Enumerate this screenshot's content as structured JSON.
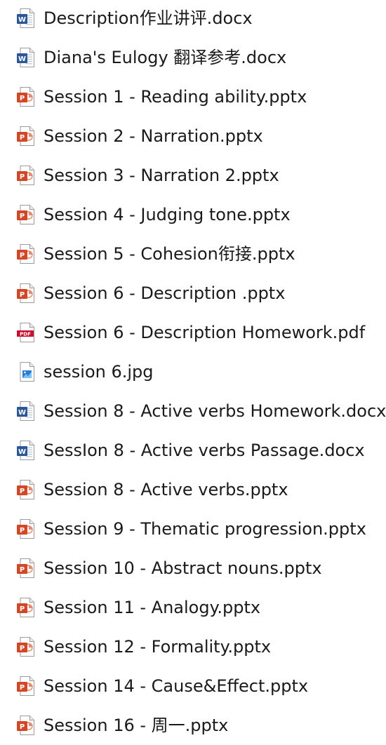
{
  "files": [
    {
      "name": "Description作业讲评.docx",
      "icon": "word-doc-icon"
    },
    {
      "name": "Diana's Eulogy 翻译参考.docx",
      "icon": "word-doc-icon"
    },
    {
      "name": "Session 1 - Reading ability.pptx",
      "icon": "powerpoint-icon"
    },
    {
      "name": "Session 2 - Narration.pptx",
      "icon": "powerpoint-icon"
    },
    {
      "name": "Session 3 - Narration 2.pptx",
      "icon": "powerpoint-icon"
    },
    {
      "name": "Session 4 - Judging tone.pptx",
      "icon": "powerpoint-icon"
    },
    {
      "name": "Session 5 - Cohesion衔接.pptx",
      "icon": "powerpoint-icon"
    },
    {
      "name": "Session 6 - Description .pptx",
      "icon": "powerpoint-icon"
    },
    {
      "name": "Session 6 - Description Homework.pdf",
      "icon": "pdf-icon"
    },
    {
      "name": "session 6.jpg",
      "icon": "image-file-icon"
    },
    {
      "name": "Session 8 - Active verbs Homework.docx",
      "icon": "word-doc-icon"
    },
    {
      "name": "SessIon 8 - Active verbs Passage.docx",
      "icon": "word-doc-icon"
    },
    {
      "name": "Session 8 - Active verbs.pptx",
      "icon": "powerpoint-icon"
    },
    {
      "name": "Session 9 - Thematic progression.pptx",
      "icon": "powerpoint-icon"
    },
    {
      "name": "Session 10 - Abstract nouns.pptx",
      "icon": "powerpoint-icon"
    },
    {
      "name": "Session 11 - Analogy.pptx",
      "icon": "powerpoint-icon"
    },
    {
      "name": "Session 12 - Formality.pptx",
      "icon": "powerpoint-icon"
    },
    {
      "name": "Session 14 - Cause&Effect.pptx",
      "icon": "powerpoint-icon"
    },
    {
      "name": "Session 16 - 周一.pptx",
      "icon": "powerpoint-icon"
    }
  ],
  "icon_colors": {
    "word": "#2b5797",
    "powerpoint": "#d24726",
    "pdf": "#c8102e",
    "image": "#2a7dd1"
  },
  "icon_glyphs": {
    "word": "W",
    "powerpoint": "P",
    "pdf": "PDF"
  }
}
